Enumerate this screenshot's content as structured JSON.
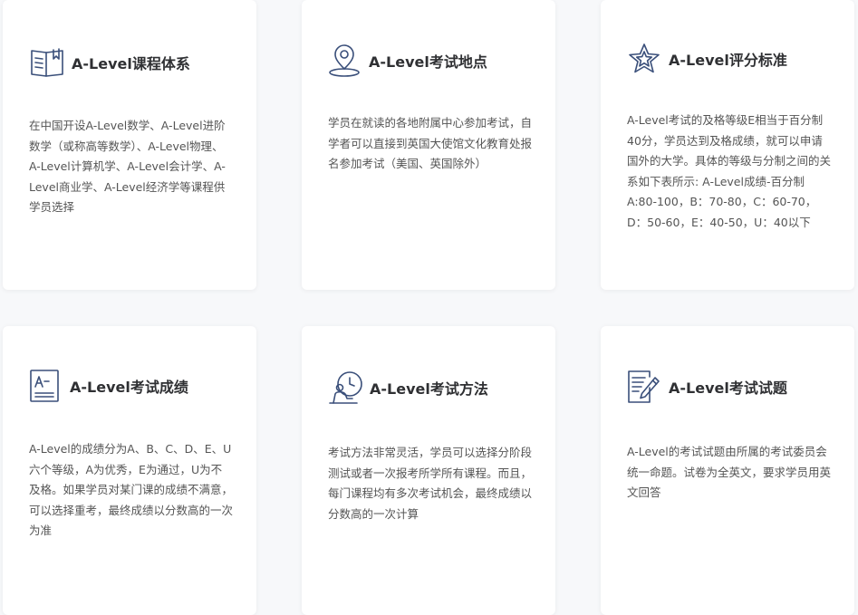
{
  "cards": [
    {
      "icon": "book-icon",
      "title": "A-Level课程体系",
      "desc": "在中国开设A-Level数学、A-Level进阶数学（或称高等数学）、A-Level物理、 A-Level计算机学、A-Level会计学、A-Level商业学、A-Level经济学等课程供学员选择"
    },
    {
      "icon": "location-pin-icon",
      "title": "A-Level考试地点",
      "desc": "学员在就读的各地附属中心参加考试，自学者可以直接到英国大使馆文化教育处报名参加考试（美国、英国除外）"
    },
    {
      "icon": "star-icon",
      "title": "A-Level评分标准",
      "desc": "A-Level考试的及格等级E相当于百分制40分，学员达到及格成绩，就可以申请国外的大学。具体的等级与分制之间的关系如下表所示: A-Level成绩-百分制A:80-100，B：70-80，C：60-70，D：50-60，E：40-50，U：40以下"
    },
    {
      "icon": "grade-sheet-icon",
      "title": "A-Level考试成绩",
      "desc": "A-Level的成绩分为A、B、C、D、E、U六个等级，A为优秀，E为通过，U为不及格。如果学员对某门课的成绩不满意，可以选择重考，最终成绩以分数高的一次为准"
    },
    {
      "icon": "student-clock-icon",
      "title": "A-Level考试方法",
      "desc": "考试方法非常灵活，学员可以选择分阶段测试或者一次报考所学所有课程。而且，每门课程均有多次考试机会，最终成绩以分数高的一次计算"
    },
    {
      "icon": "exam-paper-pen-icon",
      "title": "A-Level考试试题",
      "desc": "A-Level的考试试题由所属的考试委员会统一命题。试卷为全英文，要求学员用英文回答"
    }
  ],
  "colors": {
    "icon": "#3a4f7a",
    "title": "#2f3033",
    "text": "#555555"
  }
}
